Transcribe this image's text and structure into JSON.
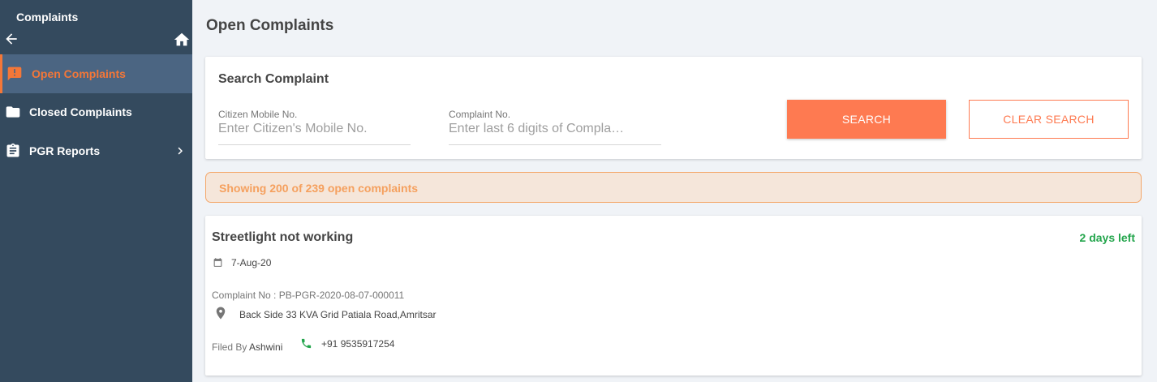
{
  "sidebar": {
    "title": "Complaints",
    "items": [
      {
        "label": "Open Complaints",
        "icon": "alert-icon"
      },
      {
        "label": "Closed Complaints",
        "icon": "folder-icon"
      },
      {
        "label": "PGR Reports",
        "icon": "clipboard-icon"
      }
    ]
  },
  "page": {
    "title": "Open Complaints"
  },
  "search": {
    "title": "Search Complaint",
    "mobile_label": "Citizen Mobile No.",
    "mobile_placeholder": "Enter Citizen's Mobile No.",
    "complaint_label": "Complaint No.",
    "complaint_placeholder": "Enter last 6 digits of Compla…",
    "search_button": "SEARCH",
    "clear_button": "CLEAR SEARCH"
  },
  "banner": {
    "text": "Showing 200 of 239 open complaints"
  },
  "complaint": {
    "title": "Streetlight not working",
    "days_left": "2 days left",
    "date": "7-Aug-20",
    "number": "Complaint No : PB-PGR-2020-08-07-000011",
    "address": "Back Side 33 KVA Grid Patiala Road,Amritsar",
    "filed_by_label": "Filed By ",
    "filed_by_name": "Ashwini",
    "phone": "+91 9535917254"
  },
  "colors": {
    "sidebar_bg": "#344a5e",
    "accent": "#fe7a51",
    "days_left": "#23a54c",
    "banner_bg": "#f5e6da"
  }
}
